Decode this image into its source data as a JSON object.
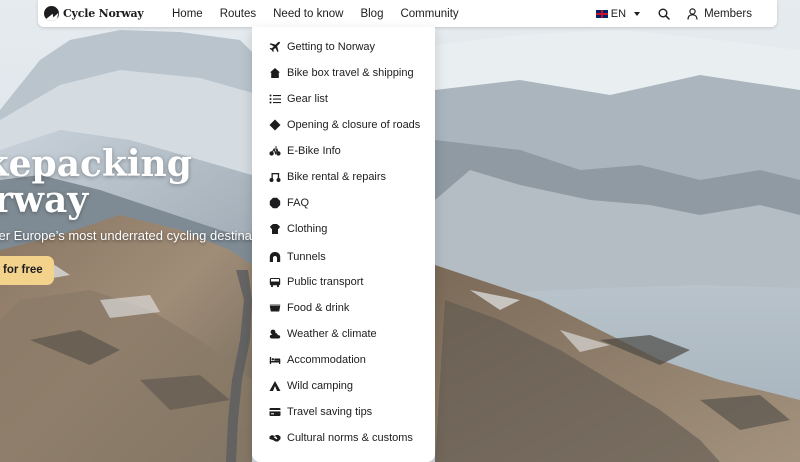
{
  "brand": {
    "name": "Cycle Norway"
  },
  "nav": {
    "links": [
      "Home",
      "Routes",
      "Need to know",
      "Blog",
      "Community"
    ],
    "language": "EN",
    "members_label": "Members"
  },
  "hero": {
    "title_line1": "ikepacking",
    "title_line2": "orway",
    "subtitle": "ver Europe’s most underrated cycling destinatio",
    "cta_label": "for free"
  },
  "dropdown": {
    "items": [
      {
        "label": "Getting to Norway",
        "icon": "plane-icon"
      },
      {
        "label": "Bike box travel & shipping",
        "icon": "house-icon"
      },
      {
        "label": "Gear list",
        "icon": "list-icon"
      },
      {
        "label": "Opening & closure of roads",
        "icon": "diamond-icon"
      },
      {
        "label": "E-Bike Info",
        "icon": "bike-icon"
      },
      {
        "label": "Bike rental & repairs",
        "icon": "rental-icon"
      },
      {
        "label": "FAQ",
        "icon": "faq-icon"
      },
      {
        "label": "Clothing",
        "icon": "clothing-icon"
      },
      {
        "label": "Tunnels",
        "icon": "tunnel-icon"
      },
      {
        "label": "Public transport",
        "icon": "bus-icon"
      },
      {
        "label": "Food & drink",
        "icon": "food-icon"
      },
      {
        "label": "Weather & climate",
        "icon": "weather-icon"
      },
      {
        "label": "Accommodation",
        "icon": "bed-icon"
      },
      {
        "label": "Wild camping",
        "icon": "tent-icon"
      },
      {
        "label": "Travel saving tips",
        "icon": "wallet-icon"
      },
      {
        "label": "Cultural norms & customs",
        "icon": "handshake-icon"
      }
    ]
  }
}
